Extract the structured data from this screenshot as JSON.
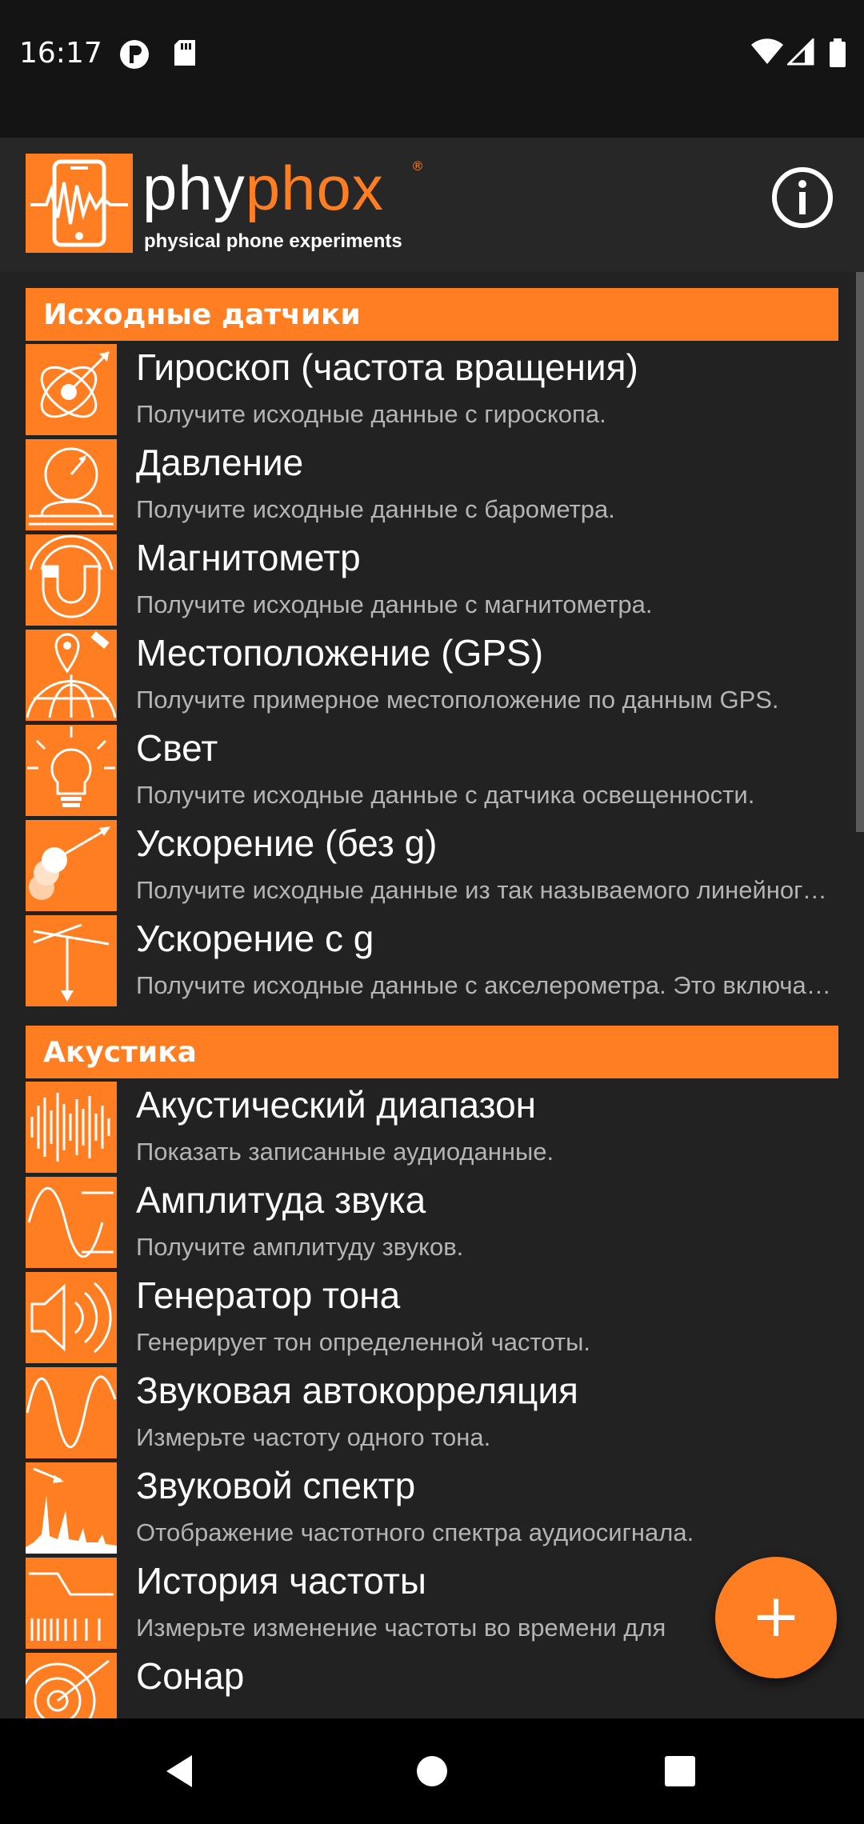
{
  "status_bar": {
    "time": "16:17"
  },
  "app_bar": {
    "logo_phy": "phy",
    "logo_phox": "phox",
    "logo_reg": "®",
    "tagline": "physical phone experiments"
  },
  "sections": [
    {
      "title": "Исходные датчики",
      "items": [
        {
          "title": "Гироскоп (частота вращения)",
          "desc": "Получите исходные данные с гироскопа.",
          "icon": "gyroscope-icon"
        },
        {
          "title": "Давление",
          "desc": "Получите исходные данные с барометра.",
          "icon": "pressure-icon"
        },
        {
          "title": "Магнитометр",
          "desc": "Получите исходные данные с магнитометра.",
          "icon": "magnet-icon"
        },
        {
          "title": "Местоположение (GPS)",
          "desc": "Получите примерное местоположение по данным GPS.",
          "icon": "location-icon"
        },
        {
          "title": "Свет",
          "desc": "Получите исходные данные с датчика освещенности.",
          "icon": "light-bulb-icon"
        },
        {
          "title": "Ускорение (без g)",
          "desc": "Получите исходные данные из так называемого линейного акселерометра.",
          "icon": "acceleration-icon"
        },
        {
          "title": "Ускорение с g",
          "desc": "Получите исходные данные с акселерометра. Это включает g.",
          "icon": "acceleration-g-icon"
        }
      ]
    },
    {
      "title": "Акустика",
      "items": [
        {
          "title": "Акустический диапазон",
          "desc": "Показать записанные аудиоданные.",
          "icon": "audio-scope-icon"
        },
        {
          "title": "Амплитуда звука",
          "desc": "Получите амплитуду звуков.",
          "icon": "amplitude-icon"
        },
        {
          "title": "Генератор тона",
          "desc": "Генерирует тон определенной частоты.",
          "icon": "speaker-icon"
        },
        {
          "title": "Звуковая автокорреляция",
          "desc": "Измерьте частоту одного тона.",
          "icon": "autocorrelation-icon"
        },
        {
          "title": "Звуковой спектр",
          "desc": "Отображение частотного спектра аудиосигнала.",
          "icon": "spectrum-icon"
        },
        {
          "title": "История частоты",
          "desc": "Измерьте изменение частоты во времени для",
          "icon": "frequency-history-icon"
        },
        {
          "title": "Сонар",
          "desc": "",
          "icon": "sonar-icon"
        }
      ]
    }
  ],
  "fab": {
    "label": "+"
  },
  "colors": {
    "accent": "#ff7e22",
    "background": "#222222",
    "appbar": "#272727",
    "subtitle": "#b4b4b4"
  }
}
